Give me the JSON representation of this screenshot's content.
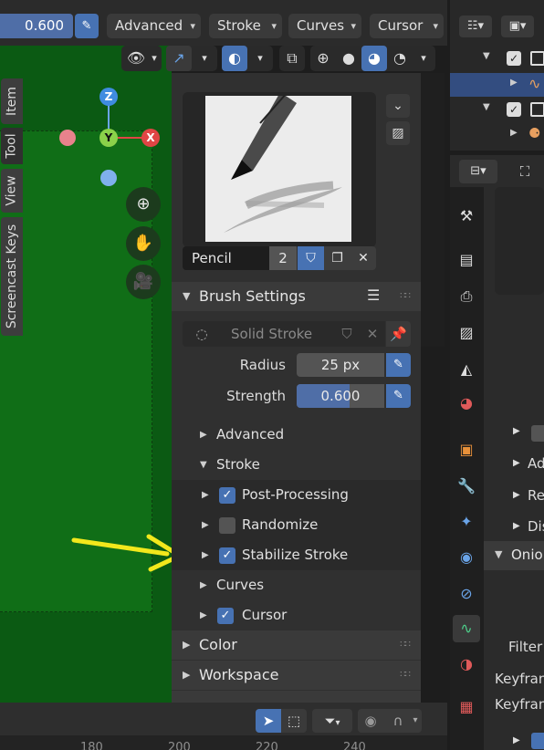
{
  "header": {
    "strength_value": "0.600",
    "menus": [
      {
        "label": "Advanced"
      },
      {
        "label": "Stroke"
      },
      {
        "label": "Curves"
      },
      {
        "label": "Cursor"
      }
    ]
  },
  "viewport": {
    "gizmo_labels": {
      "z": "Z",
      "y": "Y",
      "x": "X"
    }
  },
  "sidebar_tabs": [
    "Item",
    "Tool",
    "View",
    "Screencast Keys"
  ],
  "brush": {
    "name": "Pencil",
    "users": "2"
  },
  "brush_settings": {
    "title": "Brush Settings",
    "material_placeholder": "Solid Stroke",
    "radius_label": "Radius",
    "radius_value": "25 px",
    "strength_label": "Strength",
    "strength_value": "0.600",
    "strength_fill": 0.6
  },
  "subpanels": {
    "advanced": "Advanced",
    "stroke": "Stroke",
    "post_processing": "Post-Processing",
    "randomize": "Randomize",
    "stabilize_stroke": "Stabilize Stroke",
    "curves": "Curves",
    "cursor": "Cursor"
  },
  "checkboxes": {
    "post_processing": true,
    "randomize": false,
    "stabilize_stroke": true,
    "cursor": true
  },
  "panels": {
    "color": "Color",
    "workspace": "Workspace"
  },
  "timeline": {
    "ticks": [
      "180",
      "200",
      "220",
      "240"
    ]
  },
  "properties_editor": {
    "visible_texts": [
      "Ad",
      "Re",
      "Dis",
      "Onio",
      "Filter",
      "Keyfran",
      "Keyfran"
    ]
  },
  "colors": {
    "accent_blue": "#4772b3",
    "viewport_green": "#106e17",
    "annotation_arrow": "#f2e81c"
  }
}
